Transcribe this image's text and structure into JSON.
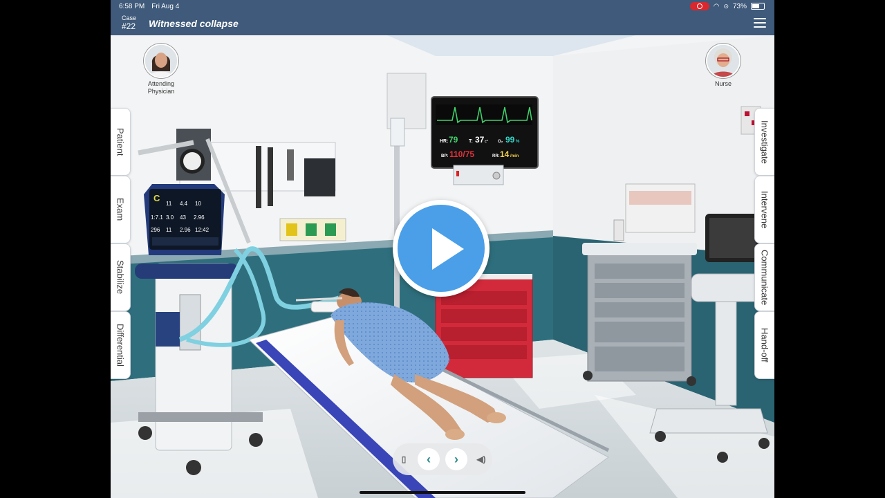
{
  "status_bar": {
    "time": "6:58 PM",
    "date": "Fri Aug 4",
    "battery": "73%",
    "battery_level": 0.73
  },
  "header": {
    "case_label": "Case",
    "case_number": "#22",
    "title": "Witnessed collapse"
  },
  "characters": [
    {
      "label": "Attending Physician"
    },
    {
      "label": "Nurse"
    }
  ],
  "left_tabs": [
    "Patient",
    "Exam",
    "Stabilize",
    "Differential"
  ],
  "right_tabs": [
    "Investigate",
    "Intervene",
    "Communicate",
    "Hand-off"
  ],
  "vitals": {
    "hr_label": "HR:",
    "hr": "79",
    "t_label": "T:",
    "t": "37",
    "t_unit": "c°",
    "o2_label": "O₂",
    "o2": "99",
    "o2_unit": "%",
    "bp_label": "BP:",
    "bp": "110/75",
    "rr_label": "RR:",
    "rr": "14",
    "rr_unit": "/min"
  },
  "ventilator_screen": {
    "row1": [
      "11",
      "4.4",
      "10"
    ],
    "row2": [
      "1:7.1",
      "3.0",
      "43",
      "2.96"
    ],
    "row3": [
      "296",
      "11",
      "2.96",
      "12:42"
    ]
  },
  "colors": {
    "header_bg": "#3f5a7a",
    "play_blue": "#4a9fe8",
    "nav_teal": "#2a8a86",
    "hr_green": "#43d16a",
    "bp_red": "#e5303a"
  }
}
